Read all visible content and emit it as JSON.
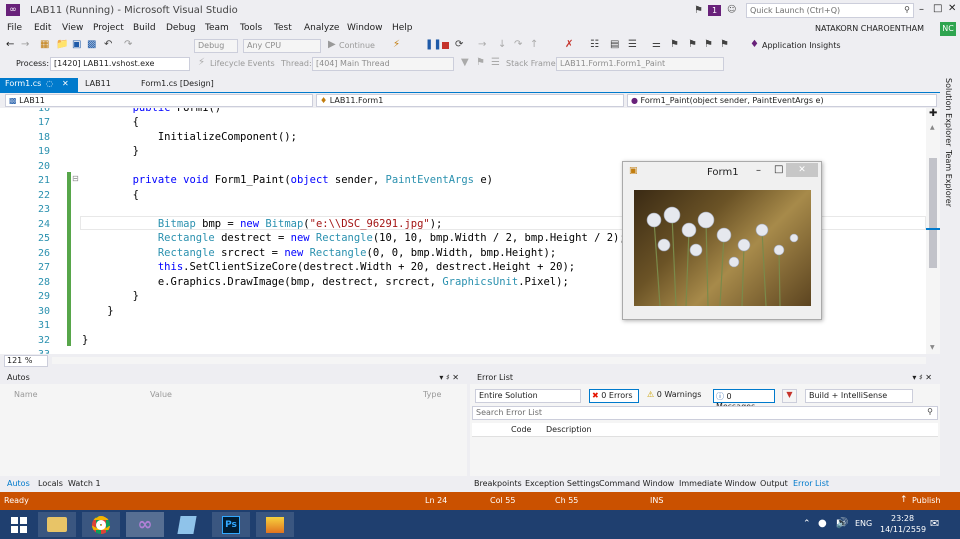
{
  "window": {
    "title": "LAB11 (Running) - Microsoft Visual Studio",
    "notification_count": "1",
    "quick_launch_placeholder": "Quick Launch (Ctrl+Q)",
    "user_name": "NATAKORN CHAROENTHAM",
    "user_initials": "NC"
  },
  "menu": [
    "File",
    "Edit",
    "View",
    "Project",
    "Build",
    "Debug",
    "Team",
    "Tools",
    "Test",
    "Analyze",
    "Window",
    "Help"
  ],
  "toolbar": {
    "config": "Debug",
    "platform": "Any CPU",
    "continue_label": "Continue",
    "app_insights": "Application Insights"
  },
  "debugbar": {
    "process_label": "Process:",
    "process": "[1420] LAB11.vshost.exe",
    "lifecycle": "Lifecycle Events",
    "thread_label": "Thread:",
    "thread": "[404] Main Thread",
    "stackframe_label": "Stack Frame:",
    "stackframe": "LAB11.Form1.Form1_Paint"
  },
  "tabs": [
    {
      "label": "Form1.cs"
    },
    {
      "label": "LAB11"
    },
    {
      "label": "Form1.cs [Design]"
    }
  ],
  "navbar": {
    "project": "LAB11",
    "class": "LAB11.Form1",
    "member": "Form1_Paint(object sender, PaintEventArgs e)"
  },
  "editor": {
    "zoom": "121 %",
    "lines": [
      "16",
      "17",
      "18",
      "19",
      "20",
      "21",
      "22",
      "23",
      "24",
      "25",
      "26",
      "27",
      "28",
      "29",
      "30",
      "31",
      "32",
      "33"
    ]
  },
  "form1": {
    "title": "Form1",
    "min": "–",
    "max": "□",
    "close": "✕"
  },
  "autos": {
    "title": "Autos",
    "col_name": "Name",
    "col_value": "Value",
    "col_type": "Type",
    "tabs": [
      "Autos",
      "Locals",
      "Watch 1"
    ]
  },
  "errorlist": {
    "title": "Error List",
    "scope": "Entire Solution",
    "errors": "0 Errors",
    "warnings": "0 Warnings",
    "messages": "0 Messages",
    "build": "Build + IntelliSense",
    "search_placeholder": "Search Error List",
    "col_code": "Code",
    "col_desc": "Description",
    "tabs": [
      "Breakpoints",
      "Exception Settings",
      "Command Window",
      "Immediate Window",
      "Output",
      "Error List"
    ]
  },
  "rail": {
    "solution_explorer": "Solution Explorer",
    "team_explorer": "Team Explorer"
  },
  "status": {
    "state": "Ready",
    "line": "Ln 24",
    "col": "Col 55",
    "ch": "Ch 55",
    "mode": "INS",
    "publish": "Publish"
  },
  "taskbar": {
    "lang": "ENG",
    "time": "23:28",
    "date": "14/11/2559"
  },
  "colors": {
    "accent": "#007acc",
    "statusbar": "#ca5100",
    "taskbar": "#1f3f6f"
  }
}
